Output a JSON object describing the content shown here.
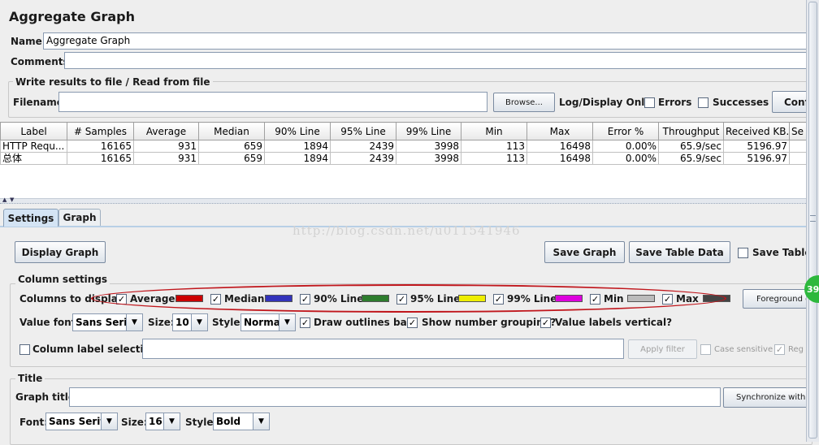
{
  "window": {
    "title": "Aggregate Graph"
  },
  "name": {
    "label": "Name:",
    "value": "Aggregate Graph"
  },
  "comments": {
    "label": "Comments:",
    "value": ""
  },
  "file_group": {
    "title": "Write results to file / Read from file",
    "filename_label": "Filename",
    "filename_value": "",
    "browse_label": "Browse...",
    "log_display_label": "Log/Display Only:",
    "errors_label": "Errors",
    "errors_checked": false,
    "successes_label": "Successes",
    "successes_checked": false,
    "configure_label": "Conf"
  },
  "table": {
    "headers": [
      "Label",
      "# Samples",
      "Average",
      "Median",
      "90% Line",
      "95% Line",
      "99% Line",
      "Min",
      "Max",
      "Error %",
      "Throughput",
      "Received KB...",
      "Se"
    ],
    "rows": [
      [
        "HTTP Requ...",
        "16165",
        "931",
        "659",
        "1894",
        "2439",
        "3998",
        "113",
        "16498",
        "0.00%",
        "65.9/sec",
        "5196.97",
        ""
      ],
      [
        "总体",
        "16165",
        "931",
        "659",
        "1894",
        "2439",
        "3998",
        "113",
        "16498",
        "0.00%",
        "65.9/sec",
        "5196.97",
        ""
      ]
    ]
  },
  "tabs": [
    {
      "label": "Settings",
      "active": true
    },
    {
      "label": "Graph",
      "active": false
    }
  ],
  "watermark": "http://blog.csdn.net/u011541946",
  "actions": {
    "display_graph": "Display Graph",
    "save_graph": "Save Graph",
    "save_table_data": "Save Table Data",
    "save_table_header": "Save Table"
  },
  "column_settings": {
    "title": "Column settings",
    "columns_label": "Columns to display:",
    "columns": [
      {
        "label": "Average",
        "checked": true,
        "color": "#cc0000"
      },
      {
        "label": "Median",
        "checked": true,
        "color": "#3333bb"
      },
      {
        "label": "90% Line",
        "checked": true,
        "color": "#2e7d2e"
      },
      {
        "label": "95% Line",
        "checked": true,
        "color": "#eeee00"
      },
      {
        "label": "99% Line",
        "checked": true,
        "color": "#dd00dd"
      },
      {
        "label": "Min",
        "checked": true,
        "color": "#bbbbbb"
      },
      {
        "label": "Max",
        "checked": true,
        "color": "#444444"
      }
    ],
    "foreground_label": "Foreground c",
    "value_font_label": "Value font:",
    "value_font": "Sans Serif",
    "size_label": "Size:",
    "size_value": "10",
    "style_label": "Style:",
    "style_value": "Normal",
    "draw_outlines_label": "Draw outlines bar?",
    "show_grouping_label": "Show number grouping?",
    "labels_vertical_label": "Value labels vertical?",
    "column_label_selection": "Column label selection:",
    "apply_filter": "Apply filter",
    "case_sensitive": "Case sensitive",
    "regexp": "Reg"
  },
  "title_group": {
    "title": "Title",
    "graph_title_label": "Graph title:",
    "graph_title_value": "",
    "sync_label": "Synchronize with",
    "font_label": "Font:",
    "font_value": "Sans Serif",
    "size_label": "Size:",
    "size_value": "16",
    "style_label": "Style:",
    "style_value": "Bold"
  },
  "badge": {
    "value": "39",
    "color": "#2db83d"
  },
  "annotation": {
    "color": "#c0161c"
  }
}
